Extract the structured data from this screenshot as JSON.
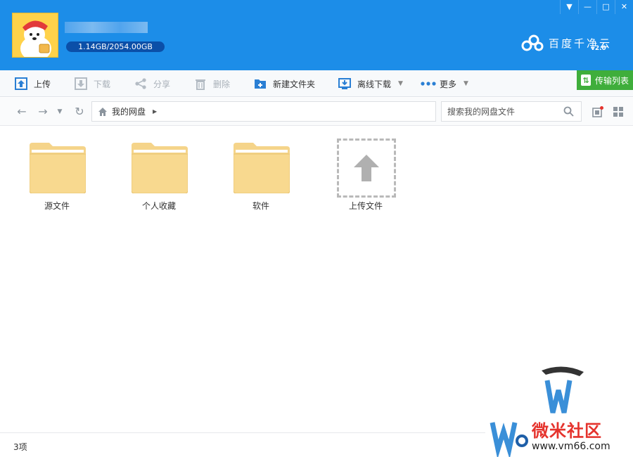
{
  "window": {
    "controls": {
      "menu": "▼",
      "minimize": "—",
      "maximize": "□",
      "close": "✕"
    }
  },
  "header": {
    "quota": "1.14GB/2054.00GB",
    "brand_name": "百度千净云",
    "brand_version": "v2.0"
  },
  "toolbar": {
    "upload": "上传",
    "download": "下载",
    "share": "分享",
    "delete": "删除",
    "new_folder": "新建文件夹",
    "offline_download": "离线下载",
    "more": "更多",
    "transfer_list": "传输列表"
  },
  "nav": {
    "breadcrumb_root": "我的网盘",
    "search_placeholder": "搜索我的网盘文件"
  },
  "files": [
    {
      "name": "源文件"
    },
    {
      "name": "个人收藏"
    },
    {
      "name": "软件"
    },
    {
      "name": "上传文件"
    }
  ],
  "status": {
    "count": "3项"
  },
  "watermark": {
    "text": "微米社区",
    "url": "www.vm66.com"
  },
  "colors": {
    "header_bg": "#1c8de8",
    "quota_bg": "#0b4fa8",
    "transfer_bg": "#3fae3b",
    "folder": "#f8d98f"
  }
}
